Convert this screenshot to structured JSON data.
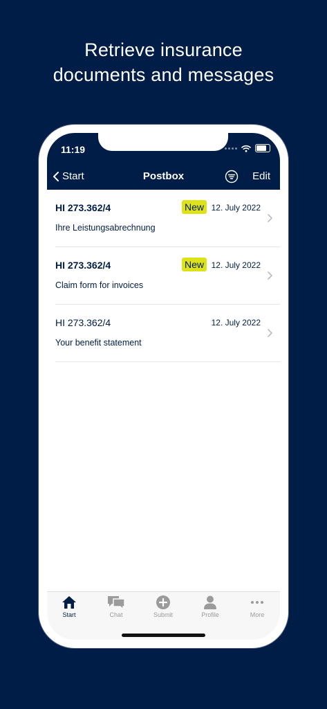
{
  "headline": {
    "line1": "Retrieve insurance",
    "line2": "documents and messages"
  },
  "status_bar": {
    "time": "11:19"
  },
  "navbar": {
    "back_label": "Start",
    "title": "Postbox",
    "edit_label": "Edit",
    "filter_icon": "filter-icon"
  },
  "messages": [
    {
      "ref": "HI 273.362/4",
      "badge": "New",
      "date": "12. July 2022",
      "subject": "Ihre Leistungsabrechnung",
      "unread": true
    },
    {
      "ref": "HI 273.362/4",
      "badge": "New",
      "date": "12. July 2022",
      "subject": "Claim form for invoices",
      "unread": true
    },
    {
      "ref": "HI 273.362/4",
      "badge": "",
      "date": "12. July 2022",
      "subject": "Your benefit statement",
      "unread": false
    }
  ],
  "tabbar": {
    "tabs": [
      {
        "label": "Start",
        "icon": "home-icon",
        "active": true
      },
      {
        "label": "Chat",
        "icon": "chat-icon",
        "active": false
      },
      {
        "label": "Submit",
        "icon": "plus-circle-icon",
        "active": false
      },
      {
        "label": "Profile",
        "icon": "person-icon",
        "active": false
      },
      {
        "label": "More",
        "icon": "more-dots-icon",
        "active": false
      }
    ]
  },
  "colors": {
    "brand_navy": "#001d47",
    "badge_yellow": "#dde219",
    "inactive_gray": "#9b9b9b"
  }
}
